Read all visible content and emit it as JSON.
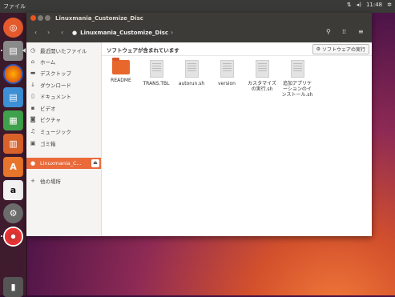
{
  "top_panel": {
    "app_name": "ファイル",
    "time": "11:48",
    "indicator_icons": [
      "network-icon",
      "volume-icon",
      "gear-icon"
    ]
  },
  "launcher": {
    "items": [
      "dash-icon",
      "files-icon",
      "firefox-icon",
      "writer-icon",
      "calc-icon",
      "impress-icon",
      "software-center-icon",
      "amazon-icon",
      "settings-icon",
      "disc-icon",
      "trash-icon"
    ]
  },
  "window": {
    "title": "Linuxmania_Customize_Disc",
    "path_segment": "Linuxmania_Customize_Disc"
  },
  "sidebar": {
    "items": [
      {
        "label": "最近開いたファイル",
        "icon": "clock-icon"
      },
      {
        "label": "ホーム",
        "icon": "home-icon"
      },
      {
        "label": "デスクトップ",
        "icon": "folder-icon"
      },
      {
        "label": "ダウンロード",
        "icon": "download-icon"
      },
      {
        "label": "ドキュメント",
        "icon": "document-icon"
      },
      {
        "label": "ビデオ",
        "icon": "video-icon"
      },
      {
        "label": "ピクチャ",
        "icon": "camera-icon"
      },
      {
        "label": "ミュージック",
        "icon": "music-icon"
      },
      {
        "label": "ゴミ箱",
        "icon": "trash-icon"
      }
    ],
    "active_device": "Linuxmania_C...",
    "other_places": "他の場所"
  },
  "main": {
    "banner_text": "ソフトウェアが含まれています",
    "run_button": "ソフトウェアの実行",
    "files": [
      {
        "name": "README",
        "type": "folder"
      },
      {
        "name": "TRANS.TBL",
        "type": "doc"
      },
      {
        "name": "autorun.sh",
        "type": "doc"
      },
      {
        "name": "version",
        "type": "doc"
      },
      {
        "name": "カスタマイズの実行.sh",
        "type": "doc"
      },
      {
        "name": "追加アプリケーションのインストール.sh",
        "type": "doc"
      }
    ]
  },
  "colors": {
    "accent": "#ea6a3a",
    "titlebar": "#3c3b37",
    "panel": "#3a3a38"
  }
}
